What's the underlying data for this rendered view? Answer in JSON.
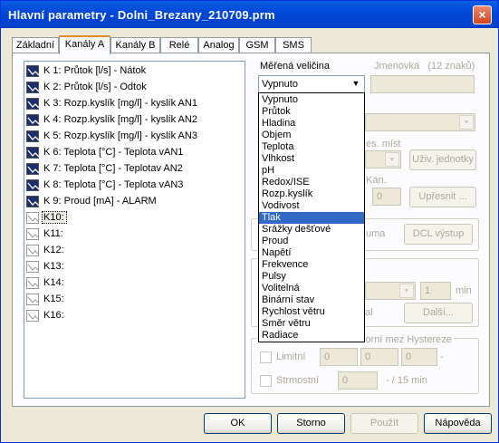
{
  "window": {
    "title": "Hlavní parametry - Dolni_Brezany_210709.prm",
    "close_glyph": "×"
  },
  "tabs": [
    "Základní",
    "Kanály A",
    "Kanály B",
    "Relé",
    "Analog",
    "GSM",
    "SMS"
  ],
  "active_tab": "Kanály A",
  "channels": [
    {
      "label": "K 1: Průtok [l/s] - Nátok",
      "enabled": true
    },
    {
      "label": "K 2: Průtok [l/s] - Odtok",
      "enabled": true
    },
    {
      "label": "K 3: Rozp.kyslík [mg/l] - kyslík AN1",
      "enabled": true
    },
    {
      "label": "K 4: Rozp.kyslík [mg/l] - kyslík AN2",
      "enabled": true
    },
    {
      "label": "K 5: Rozp.kyslík [mg/l] - kyslík AN3",
      "enabled": true
    },
    {
      "label": "K 6: Teplota [°C] - Teplota vAN1",
      "enabled": true
    },
    {
      "label": "K 7: Teplota [°C] - Teplotav AN2",
      "enabled": true
    },
    {
      "label": "K 8: Teplota [°C] - Teplota vAN3",
      "enabled": true
    },
    {
      "label": "K 9: Proud [mA] - ALARM",
      "enabled": true
    },
    {
      "label": "K10:",
      "enabled": false
    },
    {
      "label": "K11:",
      "enabled": false
    },
    {
      "label": "K12:",
      "enabled": false
    },
    {
      "label": "K13:",
      "enabled": false
    },
    {
      "label": "K14:",
      "enabled": false
    },
    {
      "label": "K15:",
      "enabled": false
    },
    {
      "label": "K16:",
      "enabled": false
    }
  ],
  "selected_channel": "K10:",
  "form": {
    "measured_label": "Měřená veličina",
    "name_label": "Jmenovka",
    "name_hint": "(12 znaků)",
    "measured_value": "Vypnuto",
    "dec_places_label": "es. míst",
    "user_units_button": "Uživ. jednotky",
    "kan_label": "Kan.",
    "kan_value": "0",
    "refine_button": "Upřesnit ...",
    "suma_label": "uma",
    "dcl_button": "DCL výstup",
    "interval_value": "1",
    "min_label": "min",
    "more_button": "Další...",
    "al_label": "al",
    "limits_header": "Dolní mez  Horní mez  Hystereze",
    "limitni_label": "Limitní",
    "limit_lower": "0",
    "limit_upper": "0",
    "limit_hyst": "0",
    "limit_hyst_suffix": "-",
    "strmostni_label": "Strmostní",
    "slope_value": "0",
    "slope_unit": "- / 15 min"
  },
  "dropdown_options": [
    "Vypnuto",
    "Průtok",
    "Hladina",
    "Objem",
    "Teplota",
    "Vlhkost",
    "pH",
    "Redox/ISE",
    "Rozp.kyslík",
    "Vodivost",
    "Tlak",
    "Srážky dešťové",
    "Proud",
    "Napětí",
    "Frekvence",
    "Pulsy",
    "Volitelná",
    "Binární stav",
    "Rychlost větru",
    "Směr větru",
    "Radiace"
  ],
  "dropdown_highlighted": "Tlak",
  "buttons": {
    "ok": "OK",
    "cancel": "Storno",
    "apply": "Použít",
    "help": "Nápověda"
  },
  "colors": {
    "title_bar": "#0a5fe3",
    "selection": "#316ac5",
    "tab_accent": "#e68b2c"
  }
}
